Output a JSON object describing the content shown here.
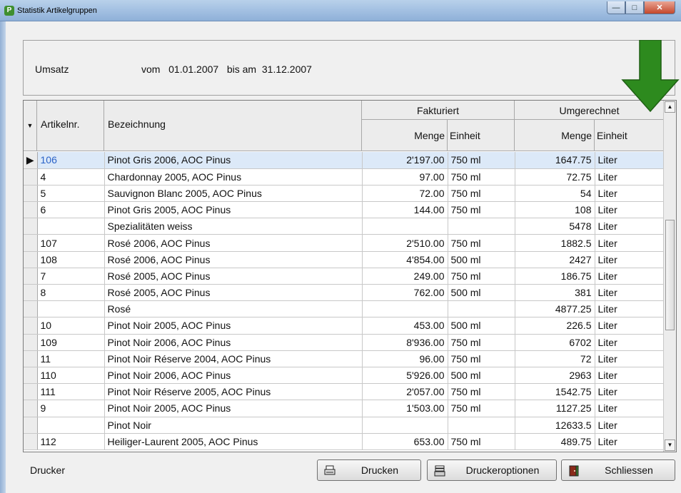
{
  "window": {
    "title": "Statistik Artikelgruppen",
    "app_icon": "P"
  },
  "header": {
    "umsatz_label": "Umsatz",
    "period_text": "vom   01.01.2007   bis am  31.12.2007"
  },
  "grid": {
    "col_artikelnr": "Artikelnr.",
    "col_bezeichnung": "Bezeichnung",
    "group_fakturiert": "Fakturiert",
    "group_umgerechnet": "Umgerechnet",
    "col_menge": "Menge",
    "col_einheit": "Einheit",
    "rows": [
      {
        "art": "106",
        "bez": "Pinot Gris 2006, AOC Pinus",
        "fmenge": "2'197.00",
        "feinheit": "750 ml",
        "umenge": "1647.75",
        "ueinheit": "Liter",
        "current": true
      },
      {
        "art": "4",
        "bez": "Chardonnay 2005, AOC Pinus",
        "fmenge": "97.00",
        "feinheit": "750 ml",
        "umenge": "72.75",
        "ueinheit": "Liter"
      },
      {
        "art": "5",
        "bez": "Sauvignon Blanc 2005, AOC Pinus",
        "fmenge": "72.00",
        "feinheit": "750 ml",
        "umenge": "54",
        "ueinheit": "Liter"
      },
      {
        "art": "6",
        "bez": "Pinot Gris 2005, AOC Pinus",
        "fmenge": "144.00",
        "feinheit": "750 ml",
        "umenge": "108",
        "ueinheit": "Liter"
      },
      {
        "art": "",
        "bez": "Spezialitäten weiss",
        "fmenge": "",
        "feinheit": "",
        "umenge": "5478",
        "ueinheit": "Liter"
      },
      {
        "art": "107",
        "bez": "Rosé 2006, AOC Pinus",
        "fmenge": "2'510.00",
        "feinheit": "750 ml",
        "umenge": "1882.5",
        "ueinheit": "Liter"
      },
      {
        "art": "108",
        "bez": "Rosé 2006, AOC Pinus",
        "fmenge": "4'854.00",
        "feinheit": "500 ml",
        "umenge": "2427",
        "ueinheit": "Liter"
      },
      {
        "art": "7",
        "bez": "Rosé 2005, AOC Pinus",
        "fmenge": "249.00",
        "feinheit": "750 ml",
        "umenge": "186.75",
        "ueinheit": "Liter"
      },
      {
        "art": "8",
        "bez": "Rosé 2005, AOC Pinus",
        "fmenge": "762.00",
        "feinheit": "500 ml",
        "umenge": "381",
        "ueinheit": "Liter"
      },
      {
        "art": "",
        "bez": "Rosé",
        "fmenge": "",
        "feinheit": "",
        "umenge": "4877.25",
        "ueinheit": "Liter"
      },
      {
        "art": "10",
        "bez": "Pinot Noir 2005, AOC Pinus",
        "fmenge": "453.00",
        "feinheit": "500 ml",
        "umenge": "226.5",
        "ueinheit": "Liter"
      },
      {
        "art": "109",
        "bez": "Pinot Noir 2006, AOC Pinus",
        "fmenge": "8'936.00",
        "feinheit": "750 ml",
        "umenge": "6702",
        "ueinheit": "Liter"
      },
      {
        "art": "11",
        "bez": "Pinot Noir Réserve 2004, AOC Pinus",
        "fmenge": "96.00",
        "feinheit": "750 ml",
        "umenge": "72",
        "ueinheit": "Liter"
      },
      {
        "art": "110",
        "bez": "Pinot Noir 2006, AOC Pinus",
        "fmenge": "5'926.00",
        "feinheit": "500 ml",
        "umenge": "2963",
        "ueinheit": "Liter"
      },
      {
        "art": "111",
        "bez": "Pinot Noir Réserve 2005, AOC Pinus",
        "fmenge": "2'057.00",
        "feinheit": "750 ml",
        "umenge": "1542.75",
        "ueinheit": "Liter"
      },
      {
        "art": "9",
        "bez": "Pinot Noir 2005, AOC Pinus",
        "fmenge": "1'503.00",
        "feinheit": "750 ml",
        "umenge": "1127.25",
        "ueinheit": "Liter"
      },
      {
        "art": "",
        "bez": "Pinot Noir",
        "fmenge": "",
        "feinheit": "",
        "umenge": "12633.5",
        "ueinheit": "Liter"
      },
      {
        "art": "112",
        "bez": "Heiliger-Laurent 2005, AOC Pinus",
        "fmenge": "653.00",
        "feinheit": "750 ml",
        "umenge": "489.75",
        "ueinheit": "Liter"
      }
    ]
  },
  "footer": {
    "drucker_label": "Drucker",
    "btn_drucken": "Drucken",
    "btn_druckeroptionen": "Druckeroptionen",
    "btn_schliessen": "Schliessen"
  },
  "colors": {
    "arrow": "#2d8a1e",
    "selected_row": "#dce9f8"
  },
  "icons": [
    "printer-icon",
    "printer-options-icon",
    "exit-door-icon",
    "sort-down-icon",
    "row-pointer-icon"
  ]
}
